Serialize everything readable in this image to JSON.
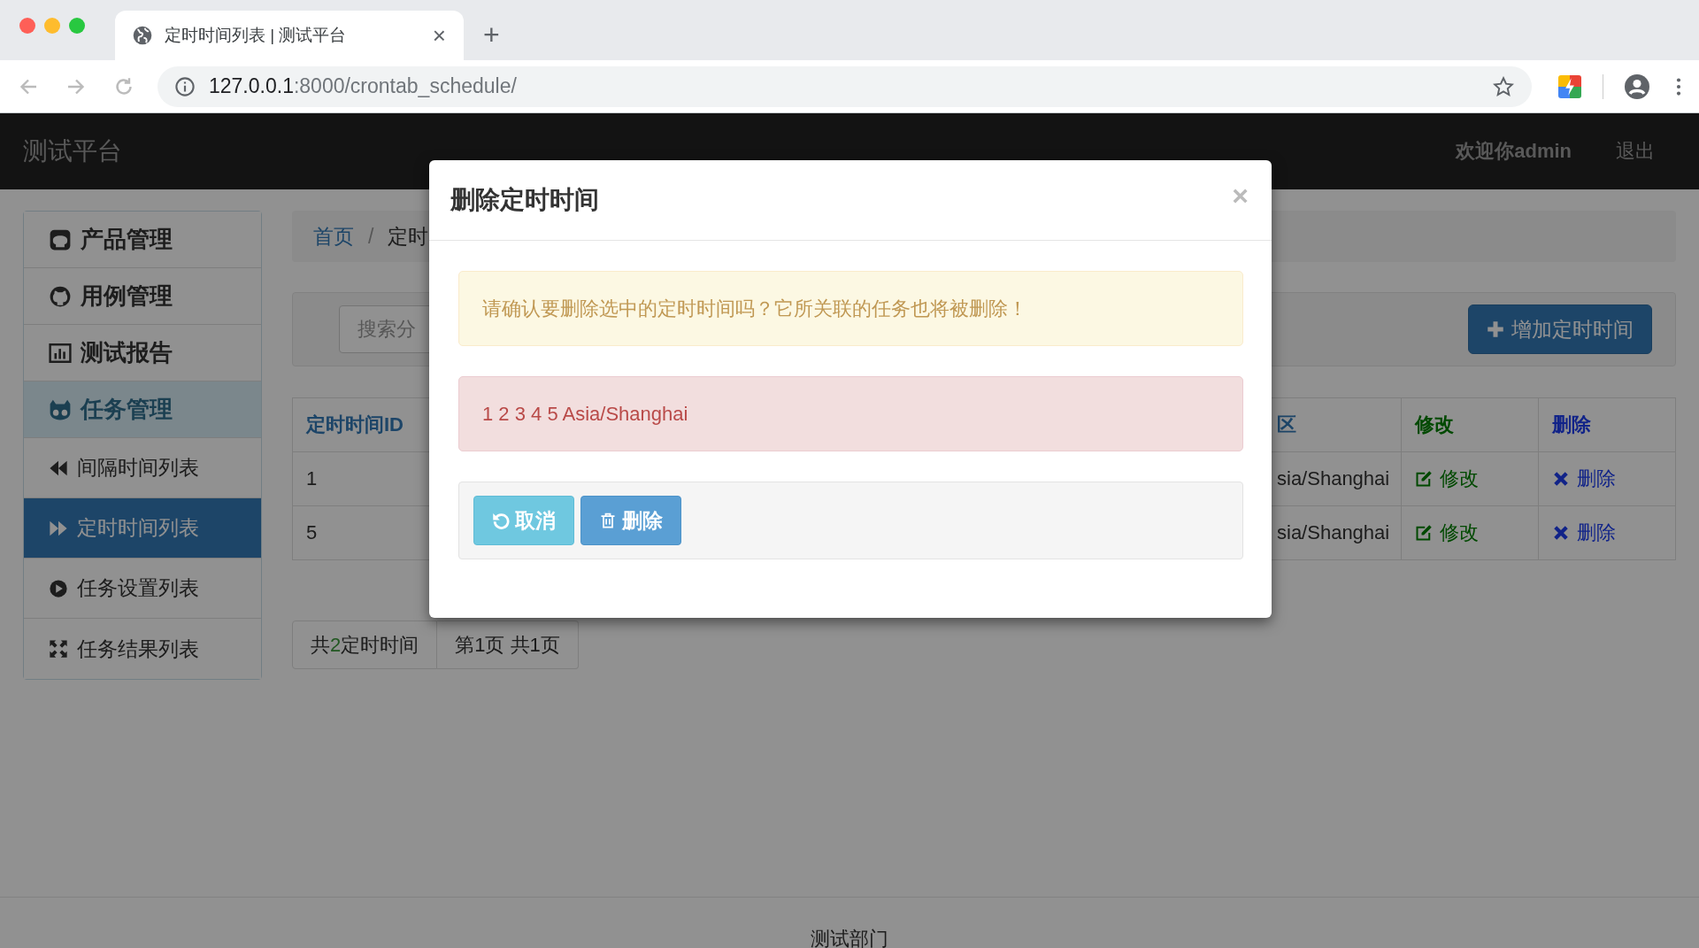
{
  "browser": {
    "tab_title": "定时时间列表 | 测试平台",
    "tab_close": "×",
    "new_tab": "+",
    "url_host": "127.0.0.1",
    "url_path": ":8000/crontab_schedule/"
  },
  "navbar": {
    "brand": "测试平台",
    "welcome": "欢迎你admin",
    "logout": "退出"
  },
  "sidebar": {
    "items": [
      {
        "label": "产品管理",
        "selected": false
      },
      {
        "label": "用例管理",
        "selected": false
      },
      {
        "label": "测试报告",
        "selected": false
      },
      {
        "label": "任务管理",
        "selected": true,
        "expanded": true,
        "children": [
          {
            "label": "间隔时间列表",
            "selected": false
          },
          {
            "label": "定时时间列表",
            "selected": true
          },
          {
            "label": "任务设置列表",
            "selected": false
          },
          {
            "label": "任务结果列表",
            "selected": false
          }
        ]
      }
    ]
  },
  "breadcrumb": {
    "items": [
      "首页",
      "定时"
    ],
    "separator": "/"
  },
  "search": {
    "placeholder": "搜索分"
  },
  "add_button": "增加定时时间",
  "table": {
    "columns": [
      {
        "label": "定时时间ID"
      },
      {
        "label": "区"
      },
      {
        "label": "修改"
      },
      {
        "label": "删除"
      }
    ],
    "rows": [
      {
        "id": "1",
        "timezone": "sia/Shanghai",
        "edit": "修改",
        "delete": "删除"
      },
      {
        "id": "5",
        "timezone": "sia/Shanghai",
        "edit": "修改",
        "delete": "删除"
      }
    ]
  },
  "pagination": {
    "total_prefix": "共",
    "total_count": "2",
    "total_suffix": "定时时间",
    "pages": "第1页 共1页"
  },
  "footer": "测试部门",
  "modal": {
    "title": "删除定时时间",
    "close": "×",
    "warning": "请确认要删除选中的定时时间吗？它所关联的任务也将被删除！",
    "item": "1 2 3 4 5 Asia/Shanghai",
    "buttons": [
      {
        "label": "取消",
        "kind": "cancel"
      },
      {
        "label": "删除",
        "kind": "delete"
      }
    ]
  }
}
